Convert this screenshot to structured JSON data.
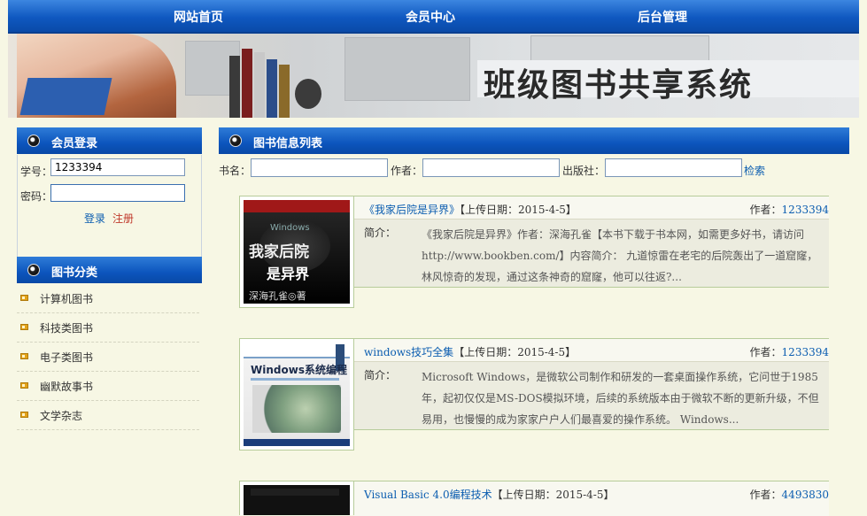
{
  "nav": {
    "items": [
      "网站首页",
      "会员中心",
      "后台管理"
    ]
  },
  "banner": {
    "site_title": "班级图书共享系统"
  },
  "login": {
    "header": "会员登录",
    "username_label": "学号：",
    "username_value": "1233394",
    "password_label": "密码：",
    "password_value": "",
    "login_link": "登录",
    "register_link": "注册"
  },
  "categories": {
    "header": "图书分类",
    "items": [
      "计算机图书",
      "科技类图书",
      "电子类图书",
      "幽默故事书",
      "文学杂志"
    ]
  },
  "book_list": {
    "header": "图书信息列表",
    "search": {
      "title_label": "书名：",
      "author_label": "作者：",
      "publisher_label": "出版社：",
      "search_link": "检索"
    },
    "books": [
      {
        "title": "《我家后院是异界》",
        "upload_date": "【上传日期：2015-4-5】",
        "author_label": "作者：",
        "author": "1233394",
        "intro_label": "简介：",
        "intro": "《我家后院是异界》作者：深海孔雀【本书下载于书本网，如需更多好书，请访问http://www.bookben.com/】内容简介： 九道惊雷在老宅的后院轰出了一道窟窿，林风惊奇的发现，通过这条神奇的窟窿，他可以往返?...",
        "cover_text_1": "我家后院",
        "cover_text_2": "是异界",
        "cover_text_3": "深海孔雀◎著",
        "cover_text_4": "Windows"
      },
      {
        "title": "windows技巧全集",
        "upload_date": "【上传日期：2015-4-5】",
        "author_label": "作者：",
        "author": "1233394",
        "intro_label": "简介：",
        "intro": "Microsoft Windows，是微软公司制作和研发的一套桌面操作系统，它问世于1985年，起初仅仅是MS-DOS模拟环境，后续的系统版本由于微软不断的更新升级，不但易用，也慢慢的成为家家户户人们最喜爱的操作系统。 Windows...",
        "cover_text_1": "Windows系统编程"
      },
      {
        "title": "Visual Basic 4.0编程技术",
        "upload_date": "【上传日期：2015-4-5】",
        "author_label": "作者：",
        "author": "4493830"
      }
    ]
  },
  "colors": {
    "nav_blue": "#0f58c0",
    "link_blue": "#0b5db0",
    "page_bg": "#f7f7e4"
  }
}
